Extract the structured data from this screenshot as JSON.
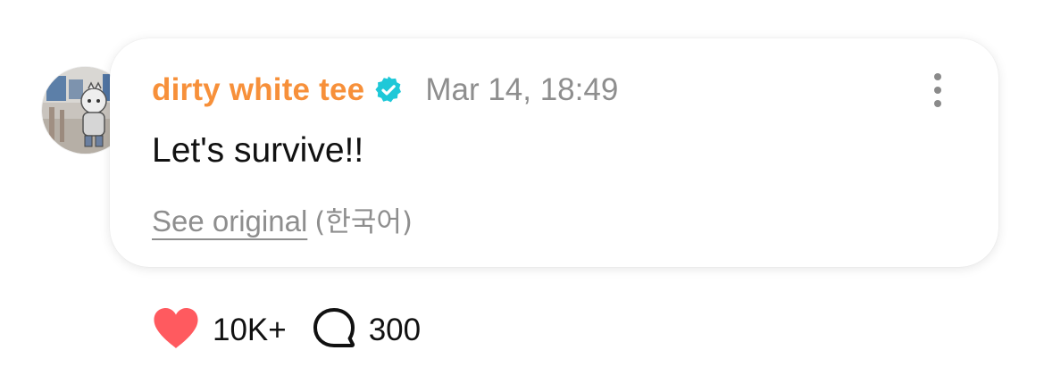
{
  "comment": {
    "author": {
      "username": "dirty white tee",
      "verified": true,
      "avatar_icon": "user-avatar"
    },
    "timestamp": "Mar 14, 18:49",
    "text": "Let's survive!!",
    "translation": {
      "link_label": "See original",
      "language": "(한국어)"
    },
    "menu_icon": "more-vertical-icon"
  },
  "actions": {
    "likes": {
      "icon": "heart-icon",
      "count": "10K+",
      "color": "#ff5a5f"
    },
    "comments": {
      "icon": "comment-icon",
      "count": "300"
    }
  },
  "colors": {
    "username": "#f7903a",
    "verified_badge": "#1ec8d8",
    "muted": "#8e8e8e"
  }
}
